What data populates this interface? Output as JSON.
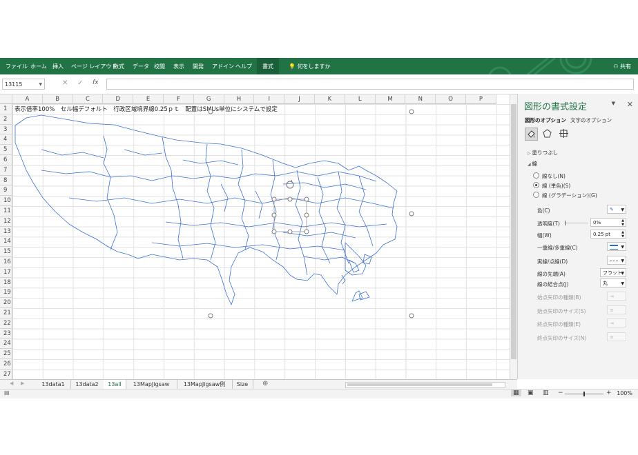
{
  "ribbon": {
    "tabs": [
      "ファイル",
      "ホーム",
      "挿入",
      "ページ レイアウト",
      "数式",
      "データ",
      "校閲",
      "表示",
      "開発",
      "アドイン",
      "ヘルプ",
      "書式"
    ],
    "tell_me": "何をしますか",
    "share": "共有"
  },
  "formula_bar": {
    "name_box": "13115",
    "fx": "fx",
    "value": ""
  },
  "columns": [
    "A",
    "B",
    "C",
    "D",
    "E",
    "F",
    "G",
    "H",
    "I",
    "J",
    "K",
    "L",
    "M",
    "N",
    "O",
    "P"
  ],
  "rows": [
    "1",
    "2",
    "3",
    "4",
    "5",
    "6",
    "7",
    "8",
    "9",
    "10",
    "11",
    "12",
    "13",
    "14",
    "15",
    "16",
    "17",
    "18",
    "19",
    "20",
    "21",
    "22",
    "23",
    "24",
    "25",
    "26",
    "27"
  ],
  "cell_a1": "表示倍率100%　セル幅デフォルト　行政区域境界線0.25ｐｔ　配置はSMUs単位にシステムで設定",
  "format_pane": {
    "title": "図形の書式設定",
    "tab_shape": "図形のオプション",
    "tab_text": "文字のオプション",
    "fill_section": "塗りつぶし",
    "line_section": "線",
    "radio_none": "線なし(N)",
    "radio_solid": "線 (単色)(S)",
    "radio_gradient": "線 (グラデーション)(G)",
    "color_label": "色(C)",
    "transparency_label": "透明度(T)",
    "transparency_value": "0%",
    "width_label": "幅(W)",
    "width_value": "0.25 pt",
    "compound_label": "一重線/多重線(C)",
    "dash_label": "実線/点線(D)",
    "cap_label": "線の先端(A)",
    "cap_value": "フラット",
    "join_label": "線の結合点(J)",
    "join_value": "丸",
    "begin_arrow_type": "始点矢印の種類(B)",
    "begin_arrow_size": "始点矢印のサイズ(S)",
    "end_arrow_type": "終点矢印の種類(E)",
    "end_arrow_size": "終点矢印のサイズ(N)"
  },
  "sheet_tabs": [
    "13data1",
    "13data2",
    "13all",
    "13MapJigsaw",
    "13MapJigsaw例",
    "Size"
  ],
  "active_sheet": "13all",
  "status": {
    "zoom": "100%"
  },
  "colors": {
    "excel_green": "#217346",
    "map_line": "#3b6fd6"
  }
}
